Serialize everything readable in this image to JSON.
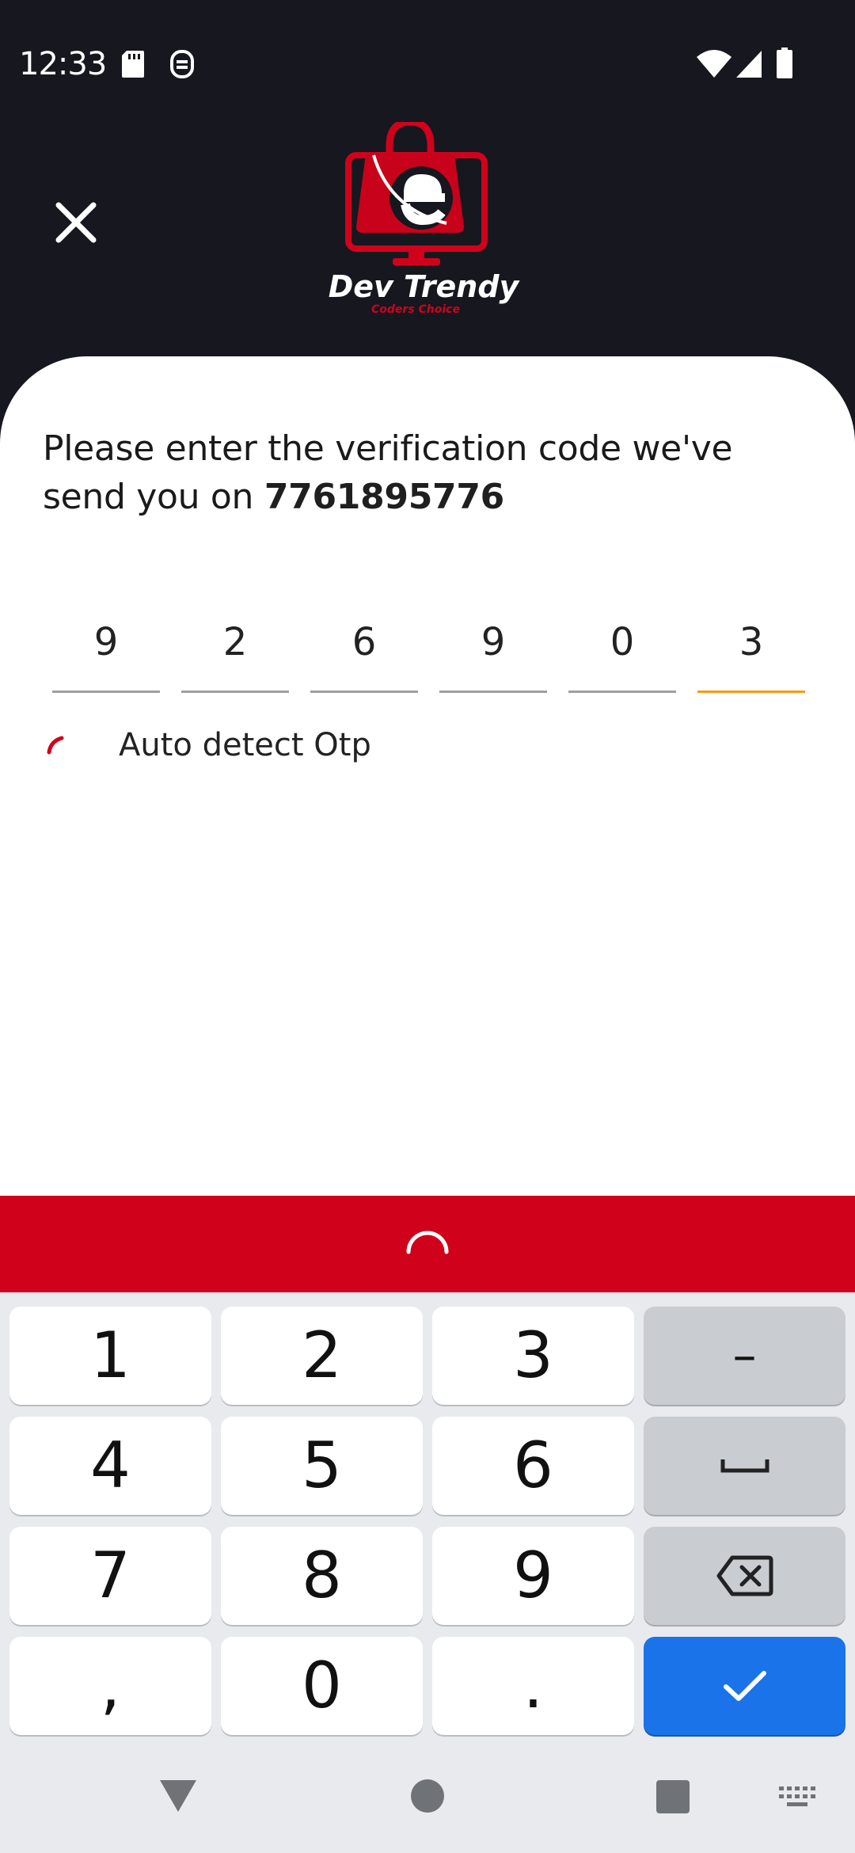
{
  "status_bar": {
    "time": "12:33",
    "icons": [
      "sd-card-icon",
      "screenshot-icon",
      "wifi-icon",
      "signal-icon",
      "battery-icon"
    ]
  },
  "header": {
    "close_icon": "close-icon",
    "brand_name": "Dev Trendy",
    "brand_tagline": "Coders Choice"
  },
  "verification": {
    "prompt": "Please enter the verification code we've send you on",
    "phone": "7761895776",
    "otp_digits": [
      "9",
      "2",
      "6",
      "9",
      "0",
      "3"
    ],
    "active_index": 5,
    "auto_detect_label": "Auto detect Otp"
  },
  "keyboard": {
    "keys": [
      "1",
      "2",
      "3",
      "–",
      "4",
      "5",
      "6",
      "space",
      "7",
      "8",
      "9",
      "backspace",
      ",",
      "0",
      ".",
      "done"
    ],
    "labels": {
      "k1": "1",
      "k2": "2",
      "k3": "3",
      "dash": "–",
      "k4": "4",
      "k5": "5",
      "k6": "6",
      "k7": "7",
      "k8": "8",
      "k9": "9",
      "comma": ",",
      "k0": "0",
      "period": "."
    }
  },
  "colors": {
    "brand_red": "#d0021b",
    "header_bg": "#16171f",
    "otp_active": "#f39c12",
    "enter_key": "#1a73e8"
  },
  "nav_bar": {
    "items": [
      "back-icon",
      "home-icon",
      "recents-icon",
      "keyboard-switch-icon"
    ]
  }
}
